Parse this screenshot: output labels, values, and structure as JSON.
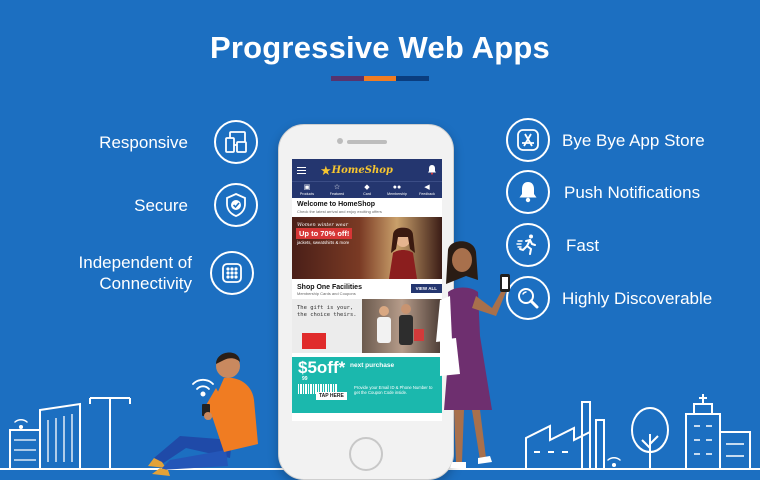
{
  "title": "Progressive Web Apps",
  "title_bar_colors": [
    "#56336e",
    "#f07c22",
    "#0a3d7f"
  ],
  "features_left": [
    {
      "label": "Responsive",
      "icon": "devices-icon"
    },
    {
      "label": "Secure",
      "icon": "shield-check-icon"
    },
    {
      "label_line1": "Independent of",
      "label_line2": "Connectivity",
      "icon": "grid-dots-icon"
    }
  ],
  "features_right": [
    {
      "label": "Bye Bye App Store",
      "icon": "app-store-icon"
    },
    {
      "label": "Push Notifications",
      "icon": "bell-icon"
    },
    {
      "label": "Fast",
      "icon": "running-man-icon"
    },
    {
      "label": "Highly Discoverable",
      "icon": "magnify-icon"
    }
  ],
  "phone": {
    "logo_text": "HomeShop",
    "nav": [
      "Products",
      "Featured",
      "Card",
      "Membership",
      "Feedback"
    ],
    "welcome_title": "Welcome to HomeShop",
    "welcome_sub": "Check the latest arrival and enjoy exciting offers",
    "banner1_script": "Women winter wear",
    "banner1_offer": "Up to 70% off!",
    "banner1_sub": "jackets, sweatshirts & more",
    "section_title": "Shop One Facilities",
    "section_sub": "Membership Cards and Coupons",
    "view_all": "VIEW ALL",
    "banner2_line1": "The gift is your,",
    "banner2_line2": "the choice theirs.",
    "banner3_big": "$5off*",
    "banner3_cents": "99",
    "banner3_next": "next purchase",
    "banner3_tap": "TAP HERE",
    "banner3_text": "Provide your Email ID & Phone Number to get the Coupon Code inside."
  },
  "colors": {
    "background": "#1c6fc1",
    "nav_bar": "#24366f",
    "teal": "#1bb8ad",
    "orange_hoodie": "#f07c22",
    "purple_dress": "#6e2f6f"
  }
}
